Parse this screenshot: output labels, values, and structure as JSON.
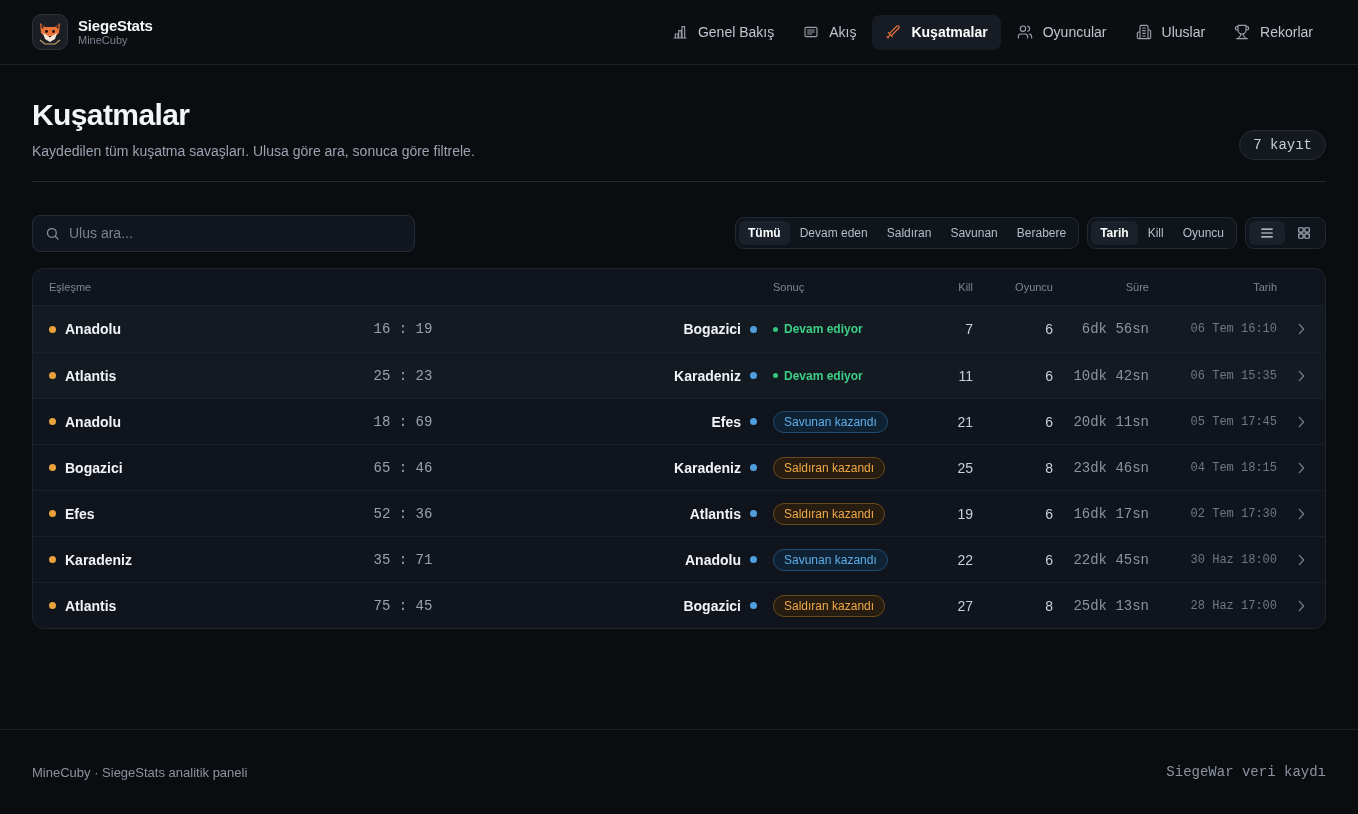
{
  "brand": {
    "name": "SiegeStats",
    "subtitle": "MineCuby"
  },
  "nav": [
    {
      "label": "Genel Bakış",
      "selected": false
    },
    {
      "label": "Akış",
      "selected": false
    },
    {
      "label": "Kuşatmalar",
      "selected": true
    },
    {
      "label": "Oyuncular",
      "selected": false
    },
    {
      "label": "Uluslar",
      "selected": false
    },
    {
      "label": "Rekorlar",
      "selected": false
    }
  ],
  "page": {
    "title": "Kuşatmalar",
    "description": "Kaydedilen tüm kuşatma savaşları. Ulusa göre ara, sonuca göre filtrele.",
    "count_badge": "7 kayıt"
  },
  "search": {
    "placeholder": "Ulus ara..."
  },
  "result_filters": [
    {
      "label": "Tümü",
      "selected": true
    },
    {
      "label": "Devam eden",
      "selected": false
    },
    {
      "label": "Saldıran",
      "selected": false
    },
    {
      "label": "Savunan",
      "selected": false
    },
    {
      "label": "Berabere",
      "selected": false
    }
  ],
  "sort_options": [
    {
      "label": "Tarih",
      "selected": true
    },
    {
      "label": "Kill",
      "selected": false
    },
    {
      "label": "Oyuncu",
      "selected": false
    }
  ],
  "view_modes": [
    {
      "selected": true
    },
    {
      "selected": false
    }
  ],
  "table": {
    "columns": [
      "Eşleşme",
      "Sonuç",
      "Kill",
      "Oyuncu",
      "Süre",
      "Tarih"
    ],
    "rows": [
      {
        "attacker": "Anadolu",
        "score": "16 : 19",
        "defender": "Bogazici",
        "result": {
          "kind": "ongoing",
          "label": "Devam ediyor"
        },
        "kills": "7",
        "players": "6",
        "duration": "6dk 56sn",
        "date": "06 Tem 16:10"
      },
      {
        "attacker": "Atlantis",
        "score": "25 : 23",
        "defender": "Karadeniz",
        "result": {
          "kind": "ongoing",
          "label": "Devam ediyor"
        },
        "kills": "11",
        "players": "6",
        "duration": "10dk 42sn",
        "date": "06 Tem 15:35"
      },
      {
        "attacker": "Anadolu",
        "score": "18 : 69",
        "defender": "Efes",
        "result": {
          "kind": "defender",
          "label": "Savunan kazandı"
        },
        "kills": "21",
        "players": "6",
        "duration": "20dk 11sn",
        "date": "05 Tem 17:45"
      },
      {
        "attacker": "Bogazici",
        "score": "65 : 46",
        "defender": "Karadeniz",
        "result": {
          "kind": "attacker",
          "label": "Saldıran kazandı"
        },
        "kills": "25",
        "players": "8",
        "duration": "23dk 46sn",
        "date": "04 Tem 18:15"
      },
      {
        "attacker": "Efes",
        "score": "52 : 36",
        "defender": "Atlantis",
        "result": {
          "kind": "attacker",
          "label": "Saldıran kazandı"
        },
        "kills": "19",
        "players": "6",
        "duration": "16dk 17sn",
        "date": "02 Tem 17:30"
      },
      {
        "attacker": "Karadeniz",
        "score": "35 : 71",
        "defender": "Anadolu",
        "result": {
          "kind": "defender",
          "label": "Savunan kazandı"
        },
        "kills": "22",
        "players": "6",
        "duration": "22dk 45sn",
        "date": "30 Haz 18:00"
      },
      {
        "attacker": "Atlantis",
        "score": "75 : 45",
        "defender": "Bogazici",
        "result": {
          "kind": "attacker",
          "label": "Saldıran kazandı"
        },
        "kills": "27",
        "players": "8",
        "duration": "25dk 13sn",
        "date": "28 Haz 17:00"
      }
    ]
  },
  "footer": {
    "left": "MineCuby · SiegeStats analitik paneli",
    "right": "SiegeWar veri kaydı"
  }
}
